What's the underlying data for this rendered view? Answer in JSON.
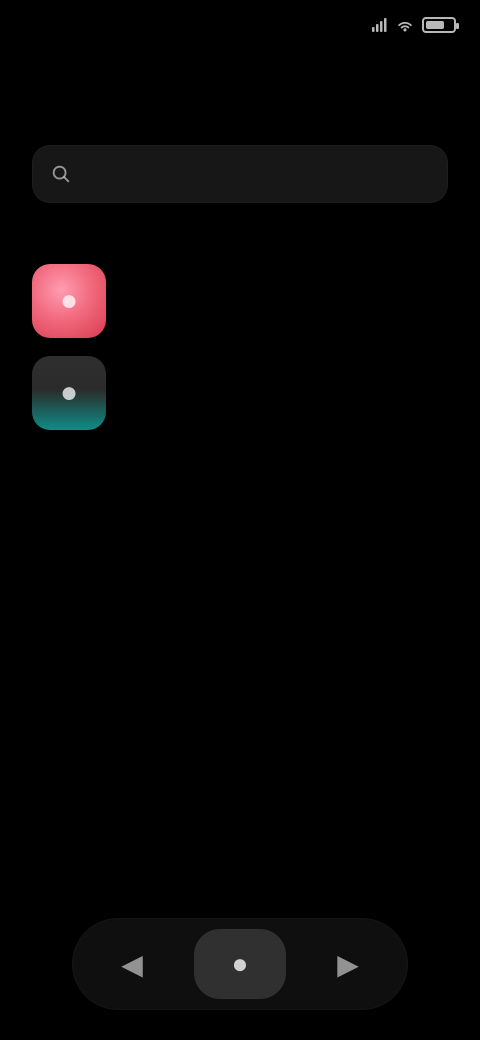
{
  "status_bar": {
    "time": "",
    "icons": [
      "signal-icon",
      "wifi-icon",
      "battery-icon"
    ],
    "battery_level": 0.7
  },
  "header": {
    "title": ""
  },
  "search": {
    "value": "",
    "placeholder": ""
  },
  "list": {
    "items": [
      {
        "title": "",
        "subtitle": "",
        "icon": "red-app-icon",
        "color": "#f26a7e"
      },
      {
        "title": "",
        "subtitle": "",
        "icon": "teal-app-icon",
        "color": "#0f8d87"
      }
    ]
  },
  "bottom_nav": {
    "items": [
      {
        "label": "",
        "icon": "left-nav-icon"
      },
      {
        "label": "",
        "icon": "home-nav-icon",
        "active": true
      },
      {
        "label": "",
        "icon": "right-nav-icon"
      }
    ]
  },
  "theme": {
    "background": "#000000"
  }
}
